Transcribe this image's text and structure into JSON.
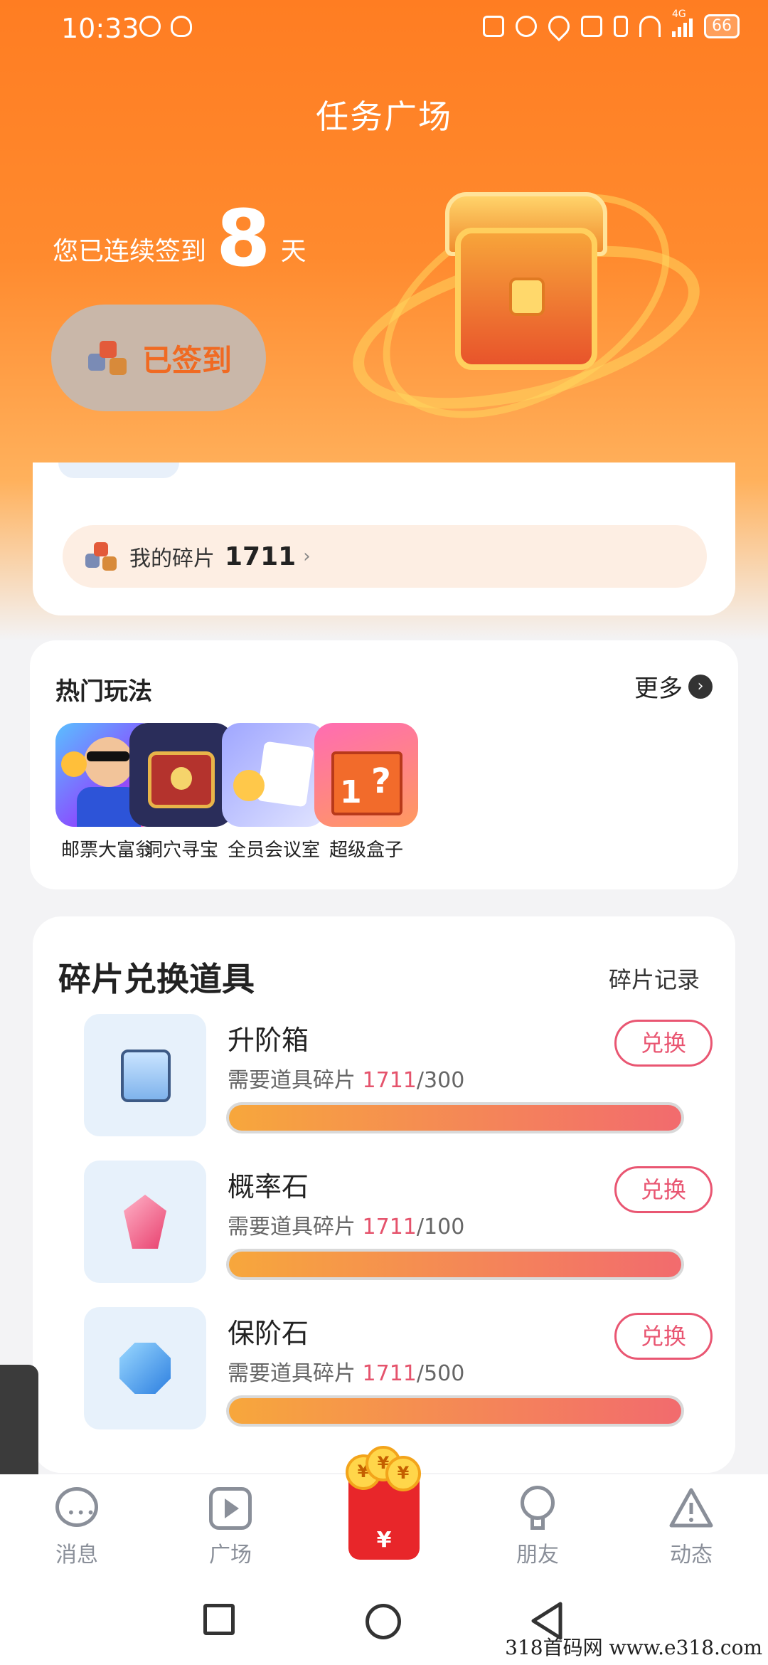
{
  "status_bar": {
    "time": "10:33",
    "battery": "66",
    "network": "4G"
  },
  "header": {
    "title": "任务广场"
  },
  "checkin": {
    "streak_prefix": "您已连续签到",
    "streak_days": "8",
    "streak_suffix": "天",
    "button_label": "已签到"
  },
  "fragments": {
    "label": "我的碎片",
    "count": "1711",
    "chevron": "›"
  },
  "hot_games": {
    "title": "热门玩法",
    "more_label": "更多",
    "items": [
      {
        "name": "邮票大富翁",
        "icon": "stamp-monopoly-icon"
      },
      {
        "name": "洞穴寻宝",
        "icon": "cave-treasure-icon"
      },
      {
        "name": "全员会议室",
        "icon": "meeting-room-icon"
      },
      {
        "name": "超级盒子",
        "icon": "super-box-icon"
      }
    ]
  },
  "exchange": {
    "title": "碎片兑换道具",
    "record_label": "碎片记录",
    "req_prefix": "需要道具碎片",
    "button_label": "兑换",
    "items": [
      {
        "name": "升阶箱",
        "have": "1711",
        "need": "/300",
        "progress": 1.0
      },
      {
        "name": "概率石",
        "have": "1711",
        "need": "/100",
        "progress": 1.0
      },
      {
        "name": "保阶石",
        "have": "1711",
        "need": "/500",
        "progress": 1.0
      }
    ]
  },
  "bottom_nav": {
    "items": [
      {
        "label": "消息",
        "icon": "message-icon"
      },
      {
        "label": "广场",
        "icon": "play-square-icon"
      },
      {
        "label": "",
        "icon": "red-packet-icon",
        "symbol": "¥"
      },
      {
        "label": "朋友",
        "icon": "lightbulb-icon"
      },
      {
        "label": "动态",
        "icon": "alert-triangle-icon"
      }
    ]
  },
  "watermark": "318首码网  www.e318.com",
  "colors": {
    "accent": "#ff7d22",
    "exchange_border": "#e95672",
    "progress_start": "#f7a73c",
    "progress_end": "#f26b6e"
  }
}
